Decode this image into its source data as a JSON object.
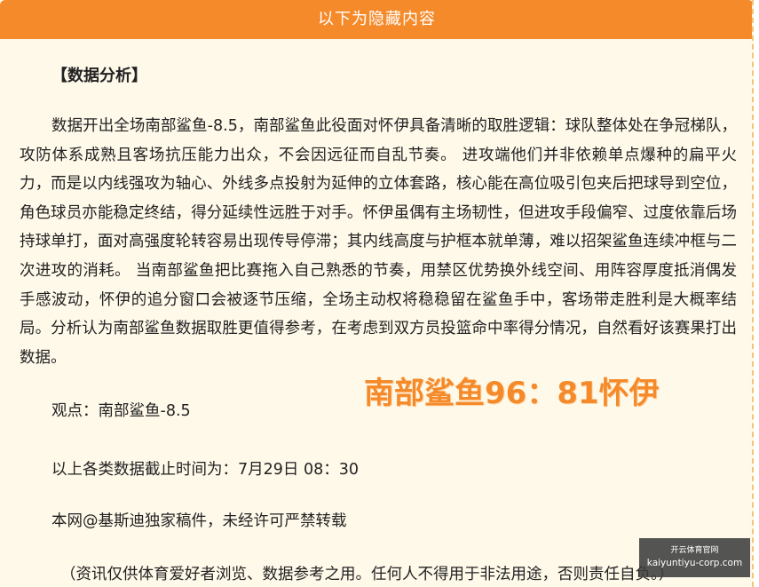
{
  "header": {
    "title": "以下为隐藏内容"
  },
  "article": {
    "section_title": "【数据分析】",
    "analysis": "数据开出全场南部鲨鱼-8.5，南部鲨鱼此役面对怀伊具备清晰的取胜逻辑：球队整体处在争冠梯队，攻防体系成熟且客场抗压能力出众，不会因远征而自乱节奏。 进攻端他们并非依赖单点爆种的扁平火力，而是以内线强攻为轴心、外线多点投射为延伸的立体套路，核心能在高位吸引包夹后把球导到空位，角色球员亦能稳定终结，得分延续性远胜于对手。怀伊虽偶有主场韧性，但进攻手段偏窄、过度依靠后场持球单打，面对高强度轮转容易出现传导停滞；其内线高度与护框本就单薄，难以招架鲨鱼连续冲框与二次进攻的消耗。 当南部鲨鱼把比赛拖入自己熟悉的节奏，用禁区优势换外线空间、用阵容厚度抵消偶发手感波动，怀伊的追分窗口会被逐节压缩，全场主动权将稳稳留在鲨鱼手中，客场带走胜利是大概率结局。分析认为南部鲨鱼数据取胜更值得参考，在考虑到双方员投篮命中率得分情况，自然看好该赛果打出数据。",
    "opinion": "观点：南部鲨鱼-8.5",
    "score_prediction": "南部鲨鱼96：81怀伊",
    "cutoff": "以上各类数据截止时间为：7月29日 08：30",
    "copyright": "本网@基斯迪独家稿件，未经许可严禁转载",
    "disclaimer": "（资讯仅供体育爱好者浏览、数据参考之用。任何人不得用于非法用途，否则责任自负。）"
  },
  "watermark": {
    "top_text": "开云体育官网",
    "domain": "kaiyuntiyu-corp.com"
  },
  "colors": {
    "header_bg": "#f58a2a",
    "panel_bg": "#fff9ea",
    "score_text": "#f58a2a",
    "border_dash": "#f5c27a"
  }
}
